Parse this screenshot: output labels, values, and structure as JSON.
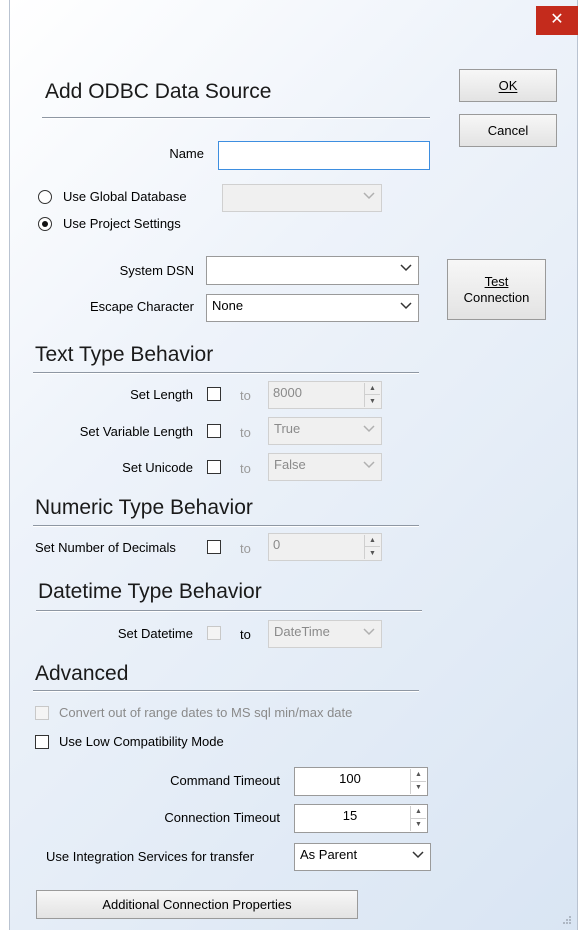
{
  "window": {
    "close_symbol": "✕"
  },
  "dialog": {
    "title": "Add ODBC Data Source"
  },
  "buttons": {
    "ok": "OK",
    "cancel": "Cancel",
    "test_connection_line1": "Test",
    "test_connection_line2": "Connection",
    "additional_properties": "Additional Connection Properties"
  },
  "name_field": {
    "label": "Name",
    "value": ""
  },
  "source": {
    "global_label": "Use Global Database",
    "global_selected": false,
    "global_value": "",
    "project_label": "Use Project Settings",
    "project_selected": true
  },
  "system_dsn": {
    "label": "System DSN",
    "value": ""
  },
  "escape_char": {
    "label": "Escape Character",
    "value": "None"
  },
  "text_type": {
    "title": "Text Type Behavior",
    "set_length": {
      "label": "Set Length",
      "to": "to",
      "value": "8000",
      "checked": false
    },
    "set_variable_length": {
      "label": "Set Variable Length",
      "to": "to",
      "value": "True",
      "checked": false
    },
    "set_unicode": {
      "label": "Set Unicode",
      "to": "to",
      "value": "False",
      "checked": false
    }
  },
  "numeric_type": {
    "title": "Numeric Type Behavior",
    "set_decimals": {
      "label": "Set Number of Decimals",
      "to": "to",
      "value": "0",
      "checked": false
    }
  },
  "datetime_type": {
    "title": "Datetime Type Behavior",
    "set_datetime": {
      "label": "Set Datetime",
      "to": "to",
      "value": "DateTime",
      "checked": false
    }
  },
  "advanced": {
    "title": "Advanced",
    "convert_dates": {
      "label": "Convert out of range dates to MS sql min/max date",
      "checked": false,
      "enabled": false
    },
    "low_compat": {
      "label": "Use Low Compatibility Mode",
      "checked": false
    },
    "command_timeout": {
      "label": "Command Timeout",
      "value": "100"
    },
    "connection_timeout": {
      "label": "Connection Timeout",
      "value": "15"
    },
    "integration_services": {
      "label": "Use Integration Services for transfer",
      "value": "As Parent"
    }
  }
}
